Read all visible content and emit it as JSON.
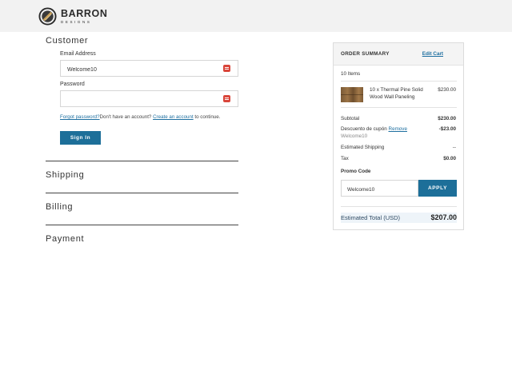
{
  "brand": {
    "name": "BARRON",
    "tagline": "DESIGNS"
  },
  "customer": {
    "title": "Customer",
    "email_label": "Email Address",
    "email_value": "Welcome10",
    "password_label": "Password",
    "password_value": "",
    "forgot_link": "Forgot password?",
    "no_account_text": "Don't have an account?",
    "create_link": "Create an account",
    "continue_text": "to continue.",
    "signin_label": "Sign In"
  },
  "steps": {
    "shipping": "Shipping",
    "billing": "Billing",
    "payment": "Payment"
  },
  "summary": {
    "title": "ORDER SUMMARY",
    "edit_cart": "Edit Cart",
    "item_count": "10 Items",
    "item": {
      "name_line1": "10 x Thermal Pine Solid",
      "name_line2": "Wood Wall Paneling",
      "price": "$230.00"
    },
    "subtotal_label": "Subtotal",
    "subtotal_value": "$230.00",
    "discount_label": "Descuento de cupón",
    "discount_remove": "Remove",
    "discount_code": "Welcome10",
    "discount_value": "-$23.00",
    "shipping_label": "Estimated Shipping",
    "shipping_value": "--",
    "tax_label": "Tax",
    "tax_value": "$0.00",
    "promo_label": "Promo Code",
    "promo_value": "Welcome10",
    "apply_label": "APPLY",
    "total_label": "Estimated Total (USD)",
    "total_value": "$207.00"
  },
  "colors": {
    "accent": "#1d6f99",
    "link": "#1e6fa0",
    "header_bg": "#f2f2f2",
    "field_icon": "#d9453a"
  }
}
